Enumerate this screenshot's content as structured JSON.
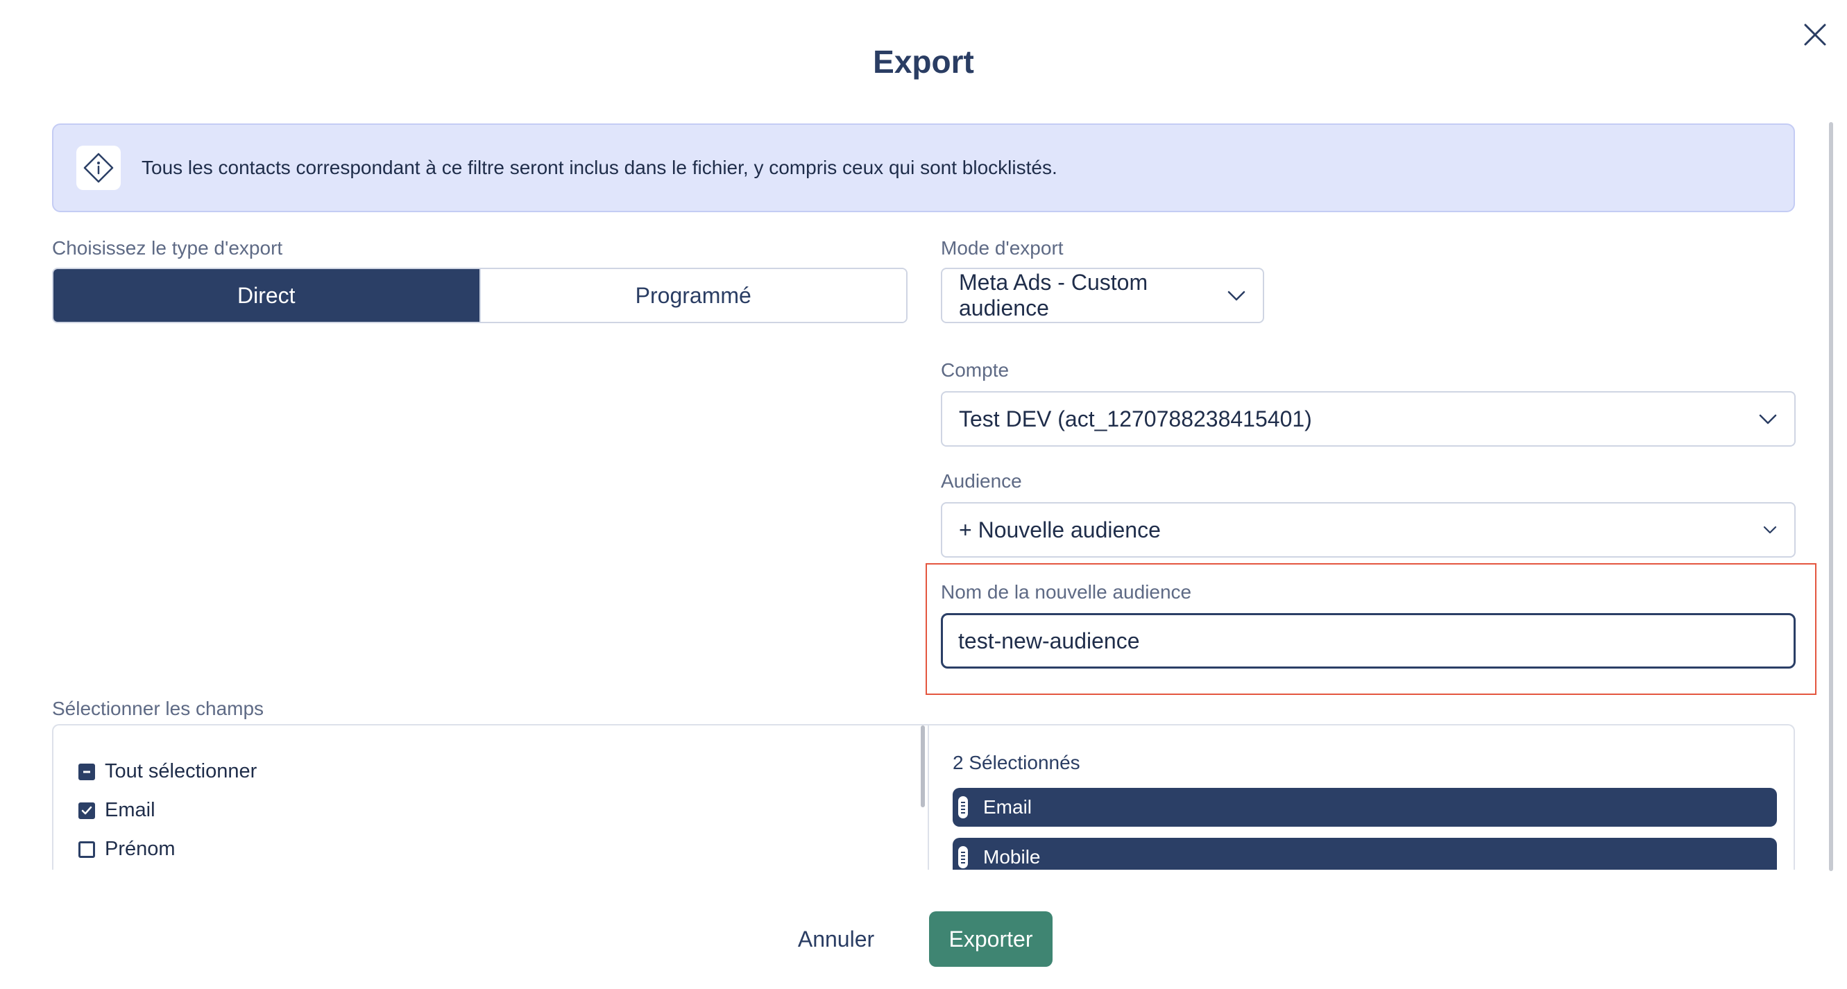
{
  "dialog": {
    "title": "Export"
  },
  "info_banner": {
    "icon": "info-diamond-icon",
    "text": "Tous les contacts correspondant à ce filtre seront inclus dans le fichier, y compris ceux qui sont blocklistés."
  },
  "export_type": {
    "label": "Choisissez le type d'export",
    "options": [
      {
        "label": "Direct",
        "selected": true
      },
      {
        "label": "Programmé",
        "selected": false
      }
    ]
  },
  "export_mode": {
    "label": "Mode d'export",
    "value": "Meta Ads - Custom audience"
  },
  "account": {
    "label": "Compte",
    "value": "Test DEV (act_1270788238415401)"
  },
  "audience": {
    "label": "Audience",
    "value": "+ Nouvelle audience"
  },
  "new_audience": {
    "label": "Nom de la nouvelle audience",
    "value": "test-new-audience"
  },
  "fields": {
    "label": "Sélectionner les champs",
    "available": [
      {
        "label": "Tout sélectionner",
        "state": "indeterminate"
      },
      {
        "label": "Email",
        "state": "checked"
      },
      {
        "label": "Prénom",
        "state": "unchecked"
      }
    ],
    "selected_count_text": "2 Sélectionnés",
    "selected": [
      "Email",
      "Mobile"
    ]
  },
  "footer": {
    "cancel_label": "Annuler",
    "export_label": "Exporter"
  },
  "colors": {
    "primary_dark": "#2b3f66",
    "export_green": "#3f8572",
    "banner_bg": "#e0e5fb",
    "highlight_red": "#e4563f"
  }
}
